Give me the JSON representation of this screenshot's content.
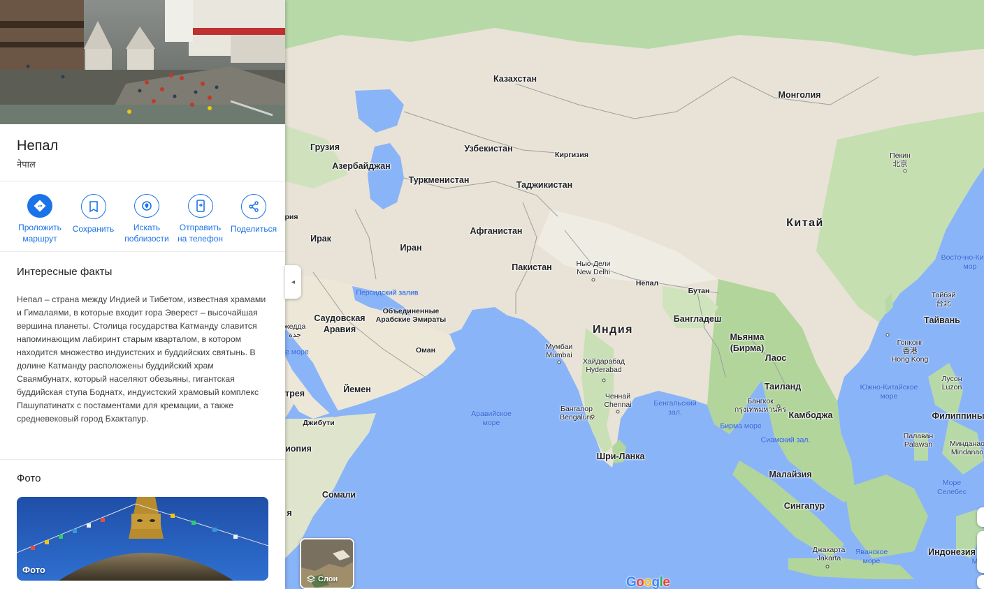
{
  "place": {
    "name": "Непал",
    "native_name": "नेपाल"
  },
  "actions": [
    {
      "label": "Проложить\nмаршрут",
      "icon": "directions-icon"
    },
    {
      "label": "Сохранить",
      "icon": "bookmark-icon"
    },
    {
      "label": "Искать\nпоблизости",
      "icon": "nearby-icon"
    },
    {
      "label": "Отправить\nна телефон",
      "icon": "phone-icon"
    },
    {
      "label": "Поделиться",
      "icon": "share-icon"
    }
  ],
  "facts": {
    "title": "Интересные факты",
    "text": "Непал – страна между Индией и Тибетом, известная храмами и Гималаями, в которые входит гора Эверест – высочайшая вершина планеты. Столица государства Катманду славится напоминающим лабиринт старым кварталом, в котором находится множество индуистских и буддийских святынь. В долине Катманду расположены буддийский храм Сваямбунатх, который населяют обезьяны, гигантская буддийская ступа Боднатх, индуистский храмовый комплекс Пашупатинатх с постаментами для кремации, а также средневековый город Бхактапур."
  },
  "photos": {
    "title": "Фото",
    "card_label": "Фото"
  },
  "map": {
    "layers_label": "Слои",
    "collapse_icon": "◂",
    "logo": [
      "G",
      "o",
      "o",
      "g",
      "l",
      "e"
    ],
    "logo_colors": [
      "#4285f4",
      "#ea4335",
      "#fbbc05",
      "#4285f4",
      "#34a853",
      "#ea4335"
    ],
    "countries": {
      "kazakhstan": "Казахстан",
      "mongolia": "Монголия",
      "georgia": "Грузия",
      "azerbaijan": "Азербайджан",
      "uzbekistan": "Узбекистан",
      "kyrgyzstan": "Киргизия",
      "turkmenistan": "Туркменистан",
      "tajikistan": "Таджикистан",
      "china": "Китай",
      "syria": "рия",
      "iraq": "Ирак",
      "iran": "Иран",
      "afghanistan": "Афганистан",
      "pakistan": "Пакистан",
      "nepal": "Непал",
      "bhutan": "Бутан",
      "india": "Индия",
      "bangladesh": "Бангладеш",
      "myanmar": "Мьянма\n(Бирма)",
      "saudi": "Саудовская\nАравия",
      "uae": "Объединенные\nАрабские Эмираты",
      "oman": "Оман",
      "yemen": "Йемен",
      "laos": "Лаос",
      "thailand": "Таиланд",
      "cambodia": "Камбоджа",
      "sri_lanka": "Шри-Ланка",
      "malaysia": "Малайзия",
      "singapore": "Сингапур",
      "philippines": "Филиппины",
      "indonesia": "Индонезия",
      "djibouti": "Джибути",
      "somalia": "Сомали",
      "eritrea": "трея",
      "ethiopia": "иопия",
      "taiwan": "Тайвань",
      "edge_ya": "я"
    },
    "cities": {
      "beijing": "Пекин\n北京",
      "new_delhi": "Нью-Дели\nNew Delhi",
      "mumbai": "Мумбаи\nMumbai",
      "hyderabad": "Хайдарабад\nHyderabad",
      "chennai": "Ченнай\nChennai",
      "bangalore": "Бангалор\nBengaluru",
      "bangkok": "Бангкок\nกรุงเทพมหานคร",
      "hong_kong": "Гонконг\n香港\nHong Kong",
      "taipei": "Тайбэй\n台北",
      "luzon": "Лусон\nLuzon",
      "palawan": "Палаван\nPalawan",
      "mindanao": "Минданао\nMindanao",
      "jakarta": "Джакарта\nJakarta",
      "jeddah": "жедда\nجدة"
    },
    "waters": {
      "persian_gulf": "Персидский залив",
      "arabian_sea": "Аравийское\nморе",
      "bay_of_bengal": "Бенгальский\nзал.",
      "burma_sea": "Бирма море",
      "gulf_of_siam": "Сиамский зал.",
      "south_china_sea": "Южно-Китайское\nморе",
      "east_china_sea": "Восточно-Китайс\nмор",
      "red_sea": "ое море",
      "java_sea": "Яванское\nморе",
      "moluccas_sea": "Море\nСелебес",
      "edge_mo": "Мо"
    }
  }
}
